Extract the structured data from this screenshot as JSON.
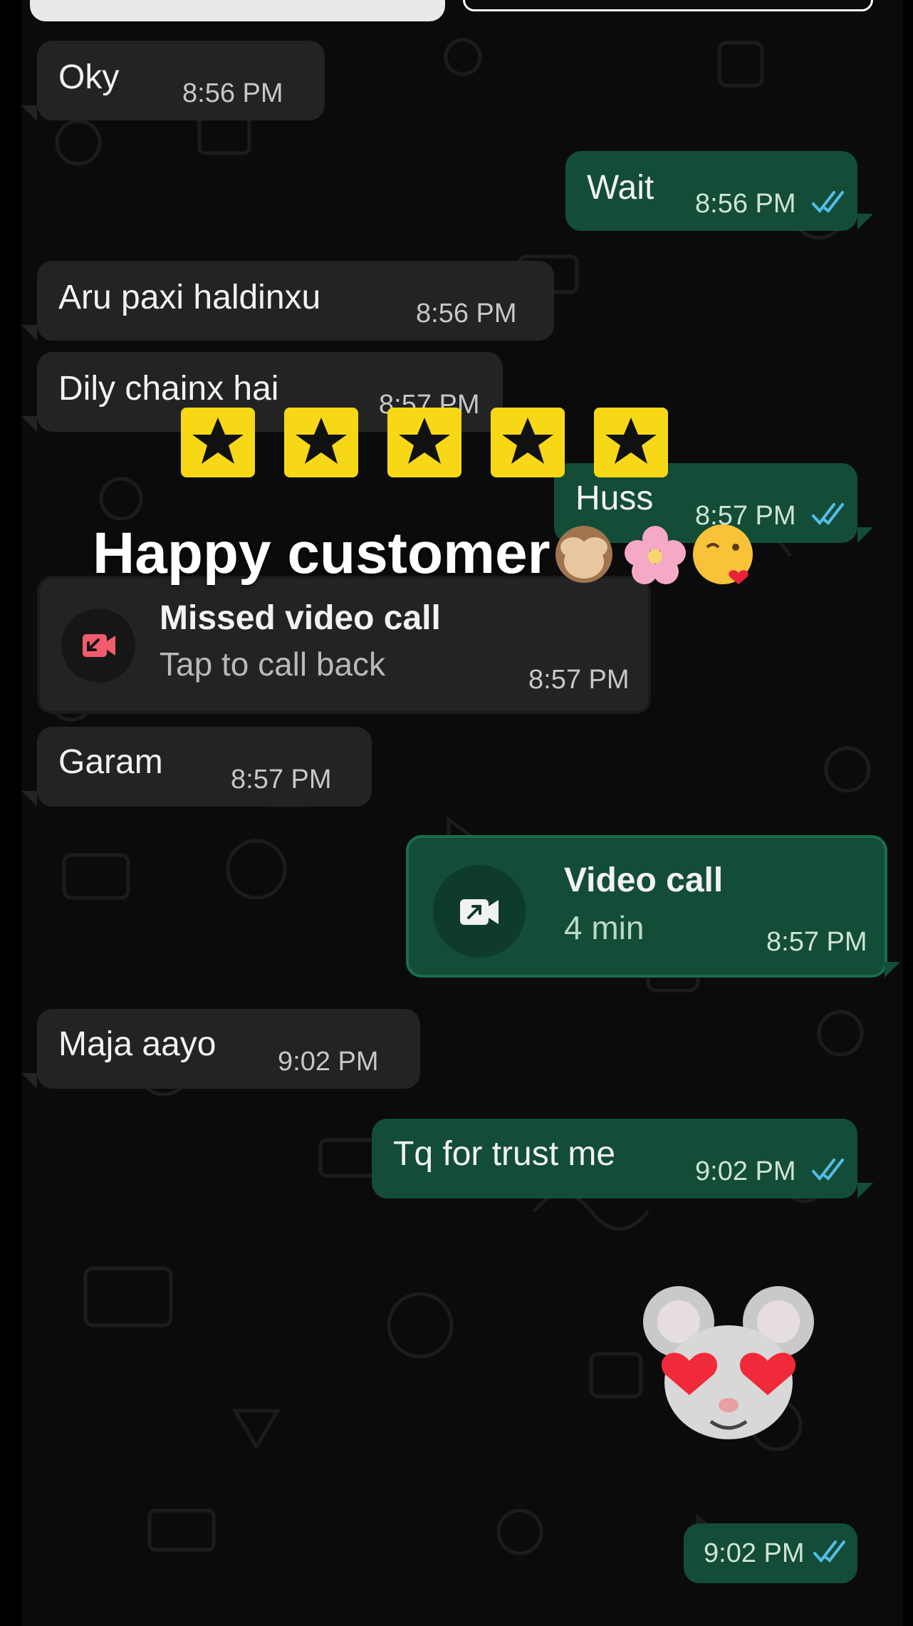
{
  "messages": {
    "oky": {
      "text": "Oky",
      "time": "8:56 PM"
    },
    "wait": {
      "text": "Wait",
      "time": "8:56 PM"
    },
    "aru": {
      "text": "Aru paxi haldinxu",
      "time": "8:56 PM"
    },
    "dily": {
      "text": "Dily chainx hai",
      "time": "8:57 PM"
    },
    "huss": {
      "text": "Huss",
      "time": "8:57 PM"
    },
    "garam": {
      "text": "Garam",
      "time": "8:57 PM"
    },
    "maja": {
      "text": "Maja aayo",
      "time": "9:02 PM"
    },
    "tq": {
      "text": "Tq for trust me",
      "time": "9:02 PM"
    },
    "sticker": {
      "time": "9:02 PM"
    }
  },
  "missed_call": {
    "title": "Missed video call",
    "subtitle": "Tap to call back",
    "time": "8:57 PM",
    "icon": "missed-video-call-icon"
  },
  "video_call": {
    "title": "Video call",
    "duration": "4 min",
    "time": "8:57 PM",
    "icon": "outgoing-video-call-icon"
  },
  "overlay": {
    "caption": "Happy customer",
    "stars": 5,
    "emojis": [
      "see-no-evil-monkey",
      "cherry-blossom",
      "face-blowing-kiss"
    ]
  },
  "colors": {
    "incoming": "#232323",
    "outgoing": "#134d37",
    "read_ticks": "#53bdeb",
    "star": "#f7d817",
    "missed": "#f15c6d"
  }
}
